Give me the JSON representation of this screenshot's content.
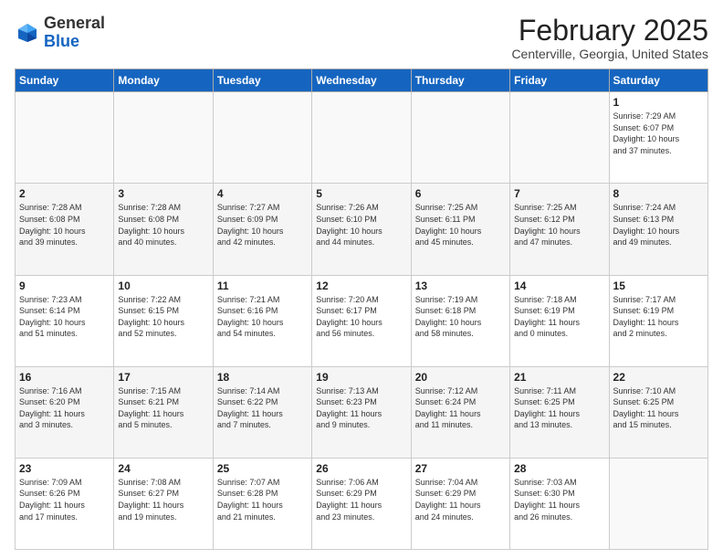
{
  "logo": {
    "general": "General",
    "blue": "Blue"
  },
  "header": {
    "title": "February 2025",
    "subtitle": "Centerville, Georgia, United States"
  },
  "weekdays": [
    "Sunday",
    "Monday",
    "Tuesday",
    "Wednesday",
    "Thursday",
    "Friday",
    "Saturday"
  ],
  "weeks": [
    [
      {
        "day": "",
        "info": ""
      },
      {
        "day": "",
        "info": ""
      },
      {
        "day": "",
        "info": ""
      },
      {
        "day": "",
        "info": ""
      },
      {
        "day": "",
        "info": ""
      },
      {
        "day": "",
        "info": ""
      },
      {
        "day": "1",
        "info": "Sunrise: 7:29 AM\nSunset: 6:07 PM\nDaylight: 10 hours\nand 37 minutes."
      }
    ],
    [
      {
        "day": "2",
        "info": "Sunrise: 7:28 AM\nSunset: 6:08 PM\nDaylight: 10 hours\nand 39 minutes."
      },
      {
        "day": "3",
        "info": "Sunrise: 7:28 AM\nSunset: 6:08 PM\nDaylight: 10 hours\nand 40 minutes."
      },
      {
        "day": "4",
        "info": "Sunrise: 7:27 AM\nSunset: 6:09 PM\nDaylight: 10 hours\nand 42 minutes."
      },
      {
        "day": "5",
        "info": "Sunrise: 7:26 AM\nSunset: 6:10 PM\nDaylight: 10 hours\nand 44 minutes."
      },
      {
        "day": "6",
        "info": "Sunrise: 7:25 AM\nSunset: 6:11 PM\nDaylight: 10 hours\nand 45 minutes."
      },
      {
        "day": "7",
        "info": "Sunrise: 7:25 AM\nSunset: 6:12 PM\nDaylight: 10 hours\nand 47 minutes."
      },
      {
        "day": "8",
        "info": "Sunrise: 7:24 AM\nSunset: 6:13 PM\nDaylight: 10 hours\nand 49 minutes."
      }
    ],
    [
      {
        "day": "9",
        "info": "Sunrise: 7:23 AM\nSunset: 6:14 PM\nDaylight: 10 hours\nand 51 minutes."
      },
      {
        "day": "10",
        "info": "Sunrise: 7:22 AM\nSunset: 6:15 PM\nDaylight: 10 hours\nand 52 minutes."
      },
      {
        "day": "11",
        "info": "Sunrise: 7:21 AM\nSunset: 6:16 PM\nDaylight: 10 hours\nand 54 minutes."
      },
      {
        "day": "12",
        "info": "Sunrise: 7:20 AM\nSunset: 6:17 PM\nDaylight: 10 hours\nand 56 minutes."
      },
      {
        "day": "13",
        "info": "Sunrise: 7:19 AM\nSunset: 6:18 PM\nDaylight: 10 hours\nand 58 minutes."
      },
      {
        "day": "14",
        "info": "Sunrise: 7:18 AM\nSunset: 6:19 PM\nDaylight: 11 hours\nand 0 minutes."
      },
      {
        "day": "15",
        "info": "Sunrise: 7:17 AM\nSunset: 6:19 PM\nDaylight: 11 hours\nand 2 minutes."
      }
    ],
    [
      {
        "day": "16",
        "info": "Sunrise: 7:16 AM\nSunset: 6:20 PM\nDaylight: 11 hours\nand 3 minutes."
      },
      {
        "day": "17",
        "info": "Sunrise: 7:15 AM\nSunset: 6:21 PM\nDaylight: 11 hours\nand 5 minutes."
      },
      {
        "day": "18",
        "info": "Sunrise: 7:14 AM\nSunset: 6:22 PM\nDaylight: 11 hours\nand 7 minutes."
      },
      {
        "day": "19",
        "info": "Sunrise: 7:13 AM\nSunset: 6:23 PM\nDaylight: 11 hours\nand 9 minutes."
      },
      {
        "day": "20",
        "info": "Sunrise: 7:12 AM\nSunset: 6:24 PM\nDaylight: 11 hours\nand 11 minutes."
      },
      {
        "day": "21",
        "info": "Sunrise: 7:11 AM\nSunset: 6:25 PM\nDaylight: 11 hours\nand 13 minutes."
      },
      {
        "day": "22",
        "info": "Sunrise: 7:10 AM\nSunset: 6:25 PM\nDaylight: 11 hours\nand 15 minutes."
      }
    ],
    [
      {
        "day": "23",
        "info": "Sunrise: 7:09 AM\nSunset: 6:26 PM\nDaylight: 11 hours\nand 17 minutes."
      },
      {
        "day": "24",
        "info": "Sunrise: 7:08 AM\nSunset: 6:27 PM\nDaylight: 11 hours\nand 19 minutes."
      },
      {
        "day": "25",
        "info": "Sunrise: 7:07 AM\nSunset: 6:28 PM\nDaylight: 11 hours\nand 21 minutes."
      },
      {
        "day": "26",
        "info": "Sunrise: 7:06 AM\nSunset: 6:29 PM\nDaylight: 11 hours\nand 23 minutes."
      },
      {
        "day": "27",
        "info": "Sunrise: 7:04 AM\nSunset: 6:29 PM\nDaylight: 11 hours\nand 24 minutes."
      },
      {
        "day": "28",
        "info": "Sunrise: 7:03 AM\nSunset: 6:30 PM\nDaylight: 11 hours\nand 26 minutes."
      },
      {
        "day": "",
        "info": ""
      }
    ]
  ]
}
